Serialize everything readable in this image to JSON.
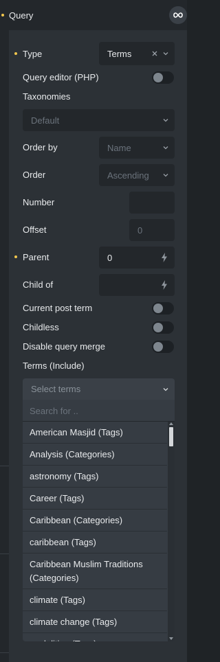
{
  "colors": {
    "accent": "#f3c74d",
    "background": "#1f2326",
    "panel": "#2c3136",
    "control": "#23272b"
  },
  "header": {
    "title": "Query",
    "loop_icon": "infinity-icon"
  },
  "fields": {
    "type": {
      "label": "Type",
      "value": "Terms"
    },
    "query_editor": {
      "label": "Query editor (PHP)"
    },
    "taxonomies": {
      "label": "Taxonomies",
      "placeholder": "Default"
    },
    "order_by": {
      "label": "Order by",
      "placeholder": "Name"
    },
    "order": {
      "label": "Order",
      "placeholder": "Ascending"
    },
    "number": {
      "label": "Number",
      "value": ""
    },
    "offset": {
      "label": "Offset",
      "placeholder": "0"
    },
    "parent": {
      "label": "Parent",
      "value": "0"
    },
    "child_of": {
      "label": "Child of",
      "value": ""
    },
    "current_post_term": {
      "label": "Current post term"
    },
    "childless": {
      "label": "Childless"
    },
    "disable_query_merge": {
      "label": "Disable query merge"
    },
    "terms_include": {
      "label": "Terms (Include)",
      "placeholder": "Select terms",
      "search_placeholder": "Search for ..",
      "options": [
        "American Masjid (Tags)",
        "Analysis (Categories)",
        "astronomy (Tags)",
        "Career (Tags)",
        "Caribbean (Categories)",
        "caribbean (Tags)",
        "Caribbean Muslim Traditions (Categories)",
        "climate (Tags)",
        "climate change (Tags)",
        "coalalition (Tags)"
      ]
    }
  }
}
